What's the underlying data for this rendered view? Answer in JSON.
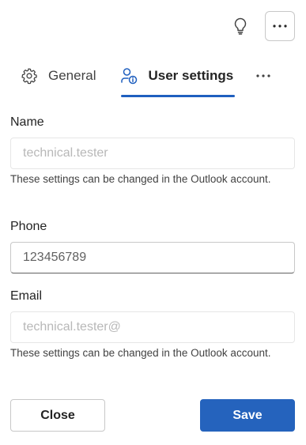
{
  "toolbar": {
    "tips_icon": "lightbulb-icon",
    "more_icon": "more-horizontal-icon"
  },
  "tabs": [
    {
      "label": "General",
      "icon": "gear-icon",
      "selected": false
    },
    {
      "label": "User settings",
      "icon": "user-info-icon",
      "selected": true
    }
  ],
  "tabs_overflow_icon": "more-horizontal-icon",
  "form": {
    "name": {
      "label": "Name",
      "value": "technical.tester",
      "disabled": true,
      "help": "These settings can be changed in the Outlook account."
    },
    "phone": {
      "label": "Phone",
      "value": "123456789",
      "disabled": false
    },
    "email": {
      "label": "Email",
      "value": "technical.tester@",
      "disabled": true,
      "help": "These settings can be changed in the Outlook account."
    }
  },
  "actions": {
    "close_label": "Close",
    "save_label": "Save"
  },
  "colors": {
    "accent": "#2563bd",
    "tab_underline": "#1f5fbf",
    "disabled_text": "#b8b8b8"
  }
}
